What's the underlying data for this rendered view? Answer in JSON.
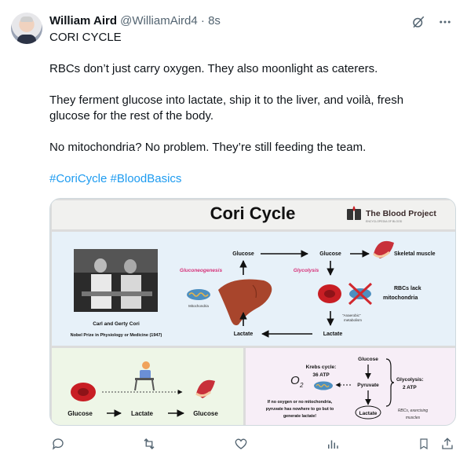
{
  "post": {
    "author_name": "William Aird",
    "handle": "@WilliamAird4",
    "separator": "·",
    "time": "8s",
    "lines": [
      "CORI CYCLE",
      "RBCs don’t just carry oxygen. They also moonlight as caterers.",
      "They ferment glucose into lactate, ship it to the liver, and voilà, fresh",
      "glucose for the rest of the body.",
      "No mitochondria? No problem. They’re still feeding the team."
    ],
    "hashtags": [
      "#CoriCycle",
      "#BloodBasics"
    ]
  },
  "header_icons": [
    "grok-icon",
    "more-icon"
  ],
  "figure": {
    "title": "Cori Cycle",
    "brand": "The Blood Project",
    "brand_sub": "ENCYCLOPEDIA OF BLOOD",
    "photo_caption_1": "Carl and Gerty Cori",
    "photo_caption_2": "Nobel Prize in Physiology or Medicine (1947)",
    "glucose_top_left": "Glucose",
    "glucose_top_right": "Glucose",
    "skeletal_muscle": "Skeletal muscle",
    "gluconeogenesis": "Gluconeogenesis",
    "glycolysis": "Glycolysis",
    "mitochondria": "Mitochondria",
    "rbc_lack_1": "RBCs lack",
    "rbc_lack_2": "mitochondria",
    "anaerobic_1": "\"Anaerobic\"",
    "anaerobic_2": "metabolism",
    "lactate_left": "Lactate",
    "lactate_right": "Lactate",
    "bottom_glucose_1": "Glucose",
    "bottom_lactate": "Lactate",
    "bottom_glucose_2": "Glucose",
    "o2": "O",
    "o2_sub": "2",
    "krebs_1": "Krebs cycle:",
    "krebs_2": "36 ATP",
    "panel_glucose": "Glucose",
    "pyruvate": "Pyruvate",
    "panel_lactate": "Lactate",
    "glycolysis_atp_1": "Glycolysis:",
    "glycolysis_atp_2": "2 ATP",
    "no_oxygen_1": "If no oxygen or no mitochondria,",
    "no_oxygen_2": "pyruvate has nowhere to go but to",
    "no_oxygen_3": "generate lactate!",
    "rbcs_exercising_1": "RBCs, exercising",
    "rbcs_exercising_2": "muscles"
  },
  "actions": [
    "reply-icon",
    "repost-icon",
    "like-icon",
    "views-icon",
    "bookmark-icon",
    "share-icon"
  ],
  "colors": {
    "link": "#1d9bf0",
    "muted": "#536471",
    "magenta": "#d6337a",
    "liver": "#a8452c",
    "rbc": "#c81e24"
  }
}
